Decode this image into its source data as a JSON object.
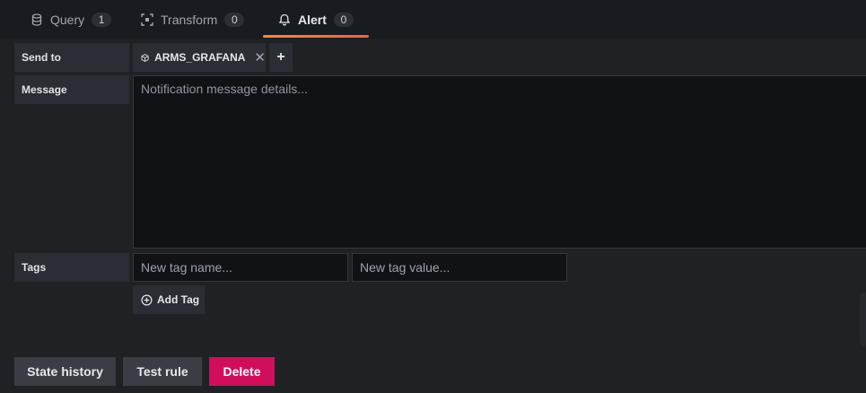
{
  "tabs": [
    {
      "label": "Query",
      "count": "1",
      "icon": "database-icon"
    },
    {
      "label": "Transform",
      "count": "0",
      "icon": "transform-icon"
    },
    {
      "label": "Alert",
      "count": "0",
      "icon": "bell-icon",
      "active": true
    }
  ],
  "colors": {
    "accent": "#ff8833",
    "danger": "#d10e5c",
    "background": "#181b1f"
  },
  "send_to": {
    "label": "Send to",
    "channels": [
      {
        "name": "ARMS_GRAFANA",
        "icon": "cube-icon"
      }
    ]
  },
  "message": {
    "label": "Message",
    "value": "",
    "placeholder": "Notification message details..."
  },
  "tags": {
    "label": "Tags",
    "name_placeholder": "New tag name...",
    "value_placeholder": "New tag value...",
    "add_label": "Add Tag"
  },
  "actions": {
    "state_history": "State history",
    "test_rule": "Test rule",
    "delete": "Delete"
  }
}
